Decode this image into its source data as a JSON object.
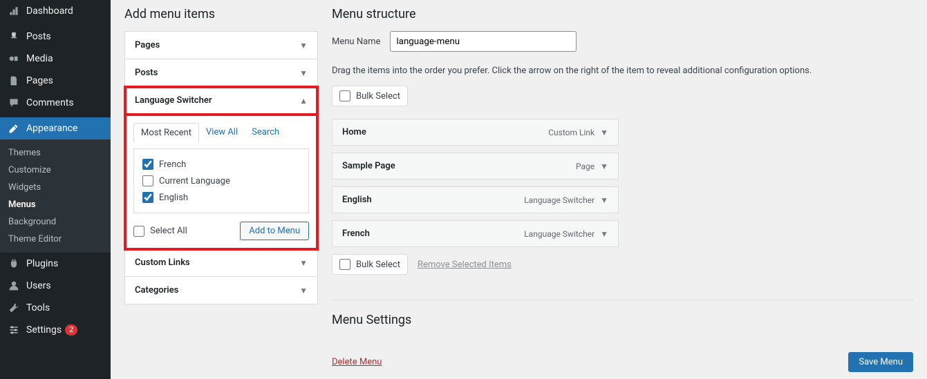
{
  "sidebar": {
    "items": [
      {
        "key": "dashboard",
        "label": "Dashboard"
      },
      {
        "key": "posts",
        "label": "Posts"
      },
      {
        "key": "media",
        "label": "Media"
      },
      {
        "key": "pages",
        "label": "Pages"
      },
      {
        "key": "comments",
        "label": "Comments"
      },
      {
        "key": "appearance",
        "label": "Appearance"
      },
      {
        "key": "plugins",
        "label": "Plugins"
      },
      {
        "key": "users",
        "label": "Users"
      },
      {
        "key": "tools",
        "label": "Tools"
      },
      {
        "key": "settings",
        "label": "Settings",
        "badge": "2"
      }
    ],
    "appearance_submenu": [
      {
        "label": "Themes"
      },
      {
        "label": "Customize"
      },
      {
        "label": "Widgets"
      },
      {
        "label": "Menus",
        "current": true
      },
      {
        "label": "Background"
      },
      {
        "label": "Theme Editor"
      }
    ]
  },
  "left": {
    "title": "Add menu items",
    "accordions": {
      "pages": "Pages",
      "posts": "Posts",
      "language_switcher": "Language Switcher",
      "custom_links": "Custom Links",
      "categories": "Categories"
    },
    "tabs": {
      "most_recent": "Most Recent",
      "view_all": "View All",
      "search": "Search"
    },
    "languages": [
      {
        "label": "French",
        "checked": true
      },
      {
        "label": "Current Language",
        "checked": false
      },
      {
        "label": "English",
        "checked": true
      }
    ],
    "select_all": "Select All",
    "add_to_menu": "Add to Menu"
  },
  "right": {
    "title": "Menu structure",
    "menu_name_label": "Menu Name",
    "menu_name_value": "language-menu",
    "instruction": "Drag the items into the order you prefer. Click the arrow on the right of the item to reveal additional configuration options.",
    "bulk_select": "Bulk Select",
    "remove_selected": "Remove Selected Items",
    "menu_items": [
      {
        "title": "Home",
        "type": "Custom Link"
      },
      {
        "title": "Sample Page",
        "type": "Page"
      },
      {
        "title": "English",
        "type": "Language Switcher"
      },
      {
        "title": "French",
        "type": "Language Switcher"
      }
    ],
    "menu_settings_title": "Menu Settings",
    "delete_menu": "Delete Menu",
    "save_menu": "Save Menu"
  }
}
